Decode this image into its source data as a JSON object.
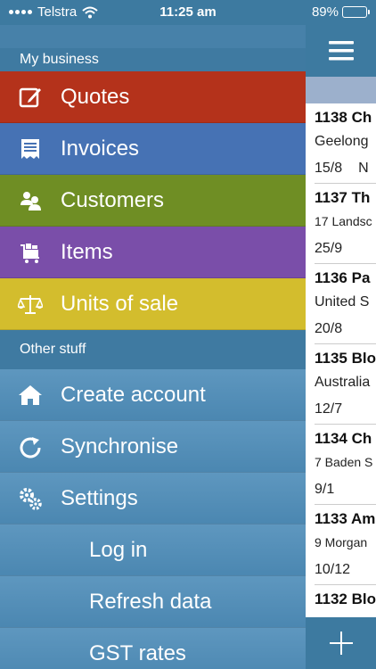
{
  "status": {
    "carrier": "Telstra",
    "time": "11:25 am",
    "battery": "89%",
    "battery_level": 0.89
  },
  "menu": {
    "section1": "My business",
    "business_items": [
      {
        "label": "Quotes",
        "icon": "edit-icon"
      },
      {
        "label": "Invoices",
        "icon": "receipt-icon"
      },
      {
        "label": "Customers",
        "icon": "people-icon"
      },
      {
        "label": "Items",
        "icon": "cart-icon"
      },
      {
        "label": "Units of sale",
        "icon": "scales-icon"
      }
    ],
    "section2": "Other stuff",
    "other_items": [
      {
        "label": "Create account",
        "icon": "home-icon"
      },
      {
        "label": "Synchronise",
        "icon": "refresh-icon"
      },
      {
        "label": "Settings",
        "icon": "gears-icon"
      },
      {
        "label": "Log in"
      },
      {
        "label": "Refresh data"
      },
      {
        "label": "GST rates"
      }
    ]
  },
  "colors": {
    "quotes": "#b4321b",
    "invoices": "#4672b4",
    "customers": "#6f8e24",
    "items": "#7a4ea9",
    "units": "#d3bd2d"
  },
  "list": [
    {
      "title": "1138 Ch",
      "sub": "Geelong",
      "date": "15/8",
      "extra": "N"
    },
    {
      "title": "1137 Th",
      "sub": "17 Landsc",
      "date": "25/9",
      "extra": ""
    },
    {
      "title": "1136 Pa",
      "sub": "United S",
      "date": "20/8",
      "extra": ""
    },
    {
      "title": "1135 Blo",
      "sub": "Australia",
      "date": "12/7",
      "extra": ""
    },
    {
      "title": "1134 Ch",
      "sub": "7 Baden S",
      "date": "9/1",
      "extra": ""
    },
    {
      "title": "1133 Am",
      "sub": "9 Morgan",
      "date": "10/12",
      "extra": ""
    },
    {
      "title": "1132 Blo",
      "sub": "",
      "date": "",
      "extra": ""
    }
  ]
}
